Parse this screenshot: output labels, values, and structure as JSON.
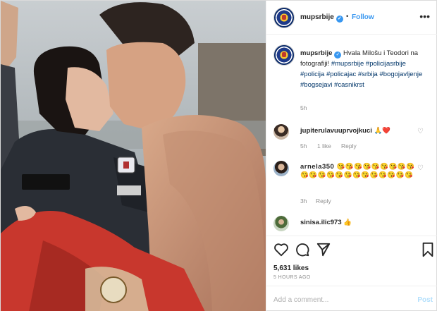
{
  "header": {
    "username": "mupsrbije",
    "separator": "•",
    "follow_label": "Follow",
    "more_icon": "more-horizontal-icon"
  },
  "caption": {
    "username": "mupsrbije",
    "text": "Hvala Milošu i Teodori na fotografiji! ",
    "tags": "#mupsrbije #policijasrbije #policija #policajac #srbija #bogojavljenje #bogsejavi #casnikrst",
    "age": "5h"
  },
  "comments": [
    {
      "username": "jupiterulavuuprvojkuci",
      "text": " 🙏❤️",
      "age": "5h",
      "likes": "1 like",
      "reply": "Reply"
    },
    {
      "username": "arnela350",
      "text": " 😘😘😘😘😘😘😘😘😘😘😘😘😘😘😘😘😘😘😘😘😘😘",
      "age": "3h",
      "reply": "Reply"
    },
    {
      "username": "sinisa.ilic973",
      "text": " 👍"
    }
  ],
  "actions": {
    "likes": "5,631 likes",
    "time": "5 HOURS AGO",
    "comment_placeholder": "Add a comment...",
    "post_label": "Post"
  },
  "colors": {
    "link_blue": "#3897f0",
    "hashtag": "#003569",
    "muted": "#8e8e8e",
    "border": "#dbdbdb"
  }
}
